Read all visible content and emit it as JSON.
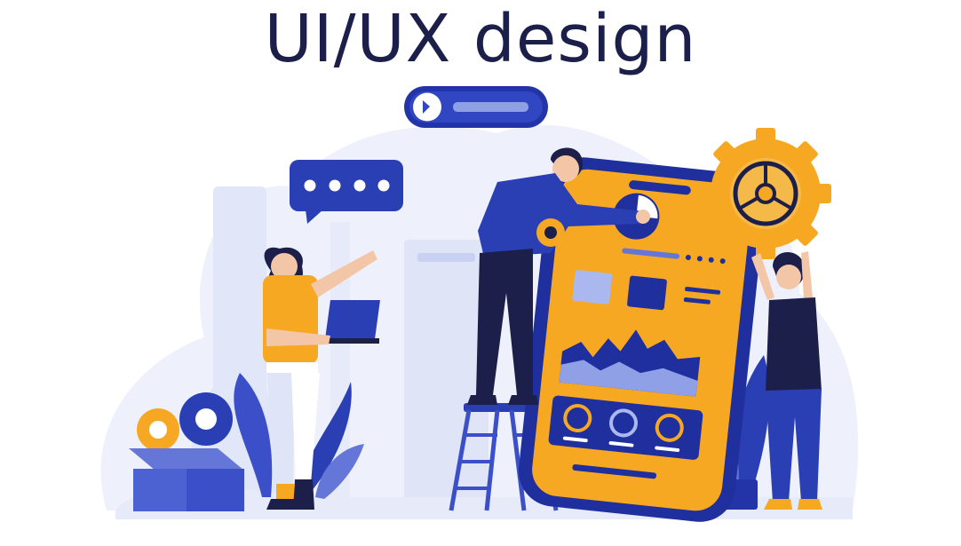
{
  "title": "UI/UX design",
  "toggle": {
    "state": "on"
  },
  "chat_bubble": {
    "dots": 4
  },
  "colors": {
    "navy": "#1c1f4a",
    "blue": "#2b3fb5",
    "orange": "#f7a823",
    "light_blue_bg": "#e3e8fa",
    "mid_blue": "#c7d0f3",
    "skin": "#f3c6a8"
  },
  "icons": [
    "gear-icon",
    "speech-bubble-icon",
    "toggle-switch-icon",
    "laptop-icon",
    "smartphone-icon",
    "ladder-icon",
    "plant-icon",
    "box-icon"
  ]
}
